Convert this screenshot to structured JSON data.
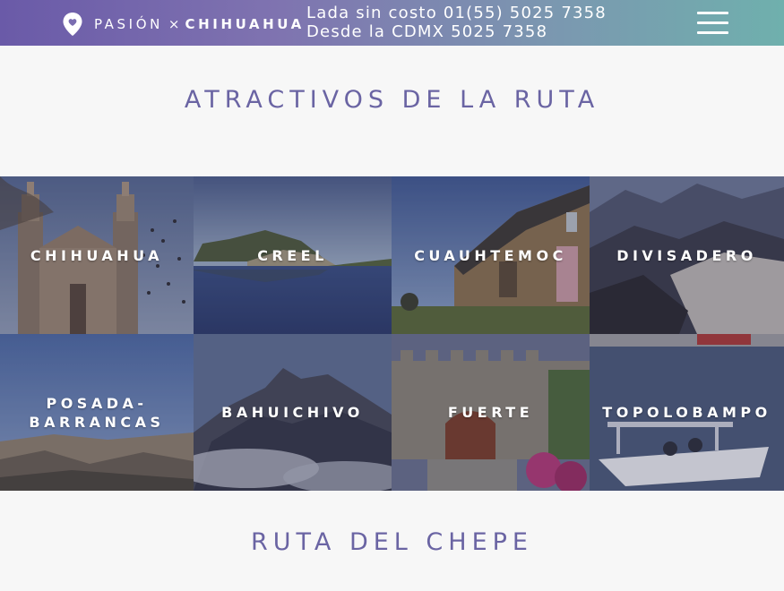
{
  "header": {
    "brand_left": "PASIÓN",
    "brand_x": "×",
    "brand_right": "CHIHUAHUA",
    "phone_line_1": "Lada sin costo 01(55) 5025 7358",
    "phone_line_2": "Desde la CDMX 5025 7358",
    "menu_icon": "hamburger-menu-icon",
    "brand_icon": "location-pin-icon"
  },
  "colors": {
    "accent": "#6a64a3",
    "gradient_start": "#6a5aa8",
    "gradient_end": "#6fb0ad",
    "background": "#f7f7f7"
  },
  "sections": {
    "attractions_title": "ATRACTIVOS DE LA RUTA",
    "route_title": "RUTA DEL CHEPE"
  },
  "attractions": [
    {
      "label": "CHIHUAHUA"
    },
    {
      "label": "CREEL"
    },
    {
      "label": "CUAUHTEMOC"
    },
    {
      "label": "DIVISADERO"
    },
    {
      "label": "POSADA- BARRANCAS"
    },
    {
      "label": "BAHUICHIVO"
    },
    {
      "label": "FUERTE"
    },
    {
      "label": "TOPOLOBAMPO"
    }
  ]
}
